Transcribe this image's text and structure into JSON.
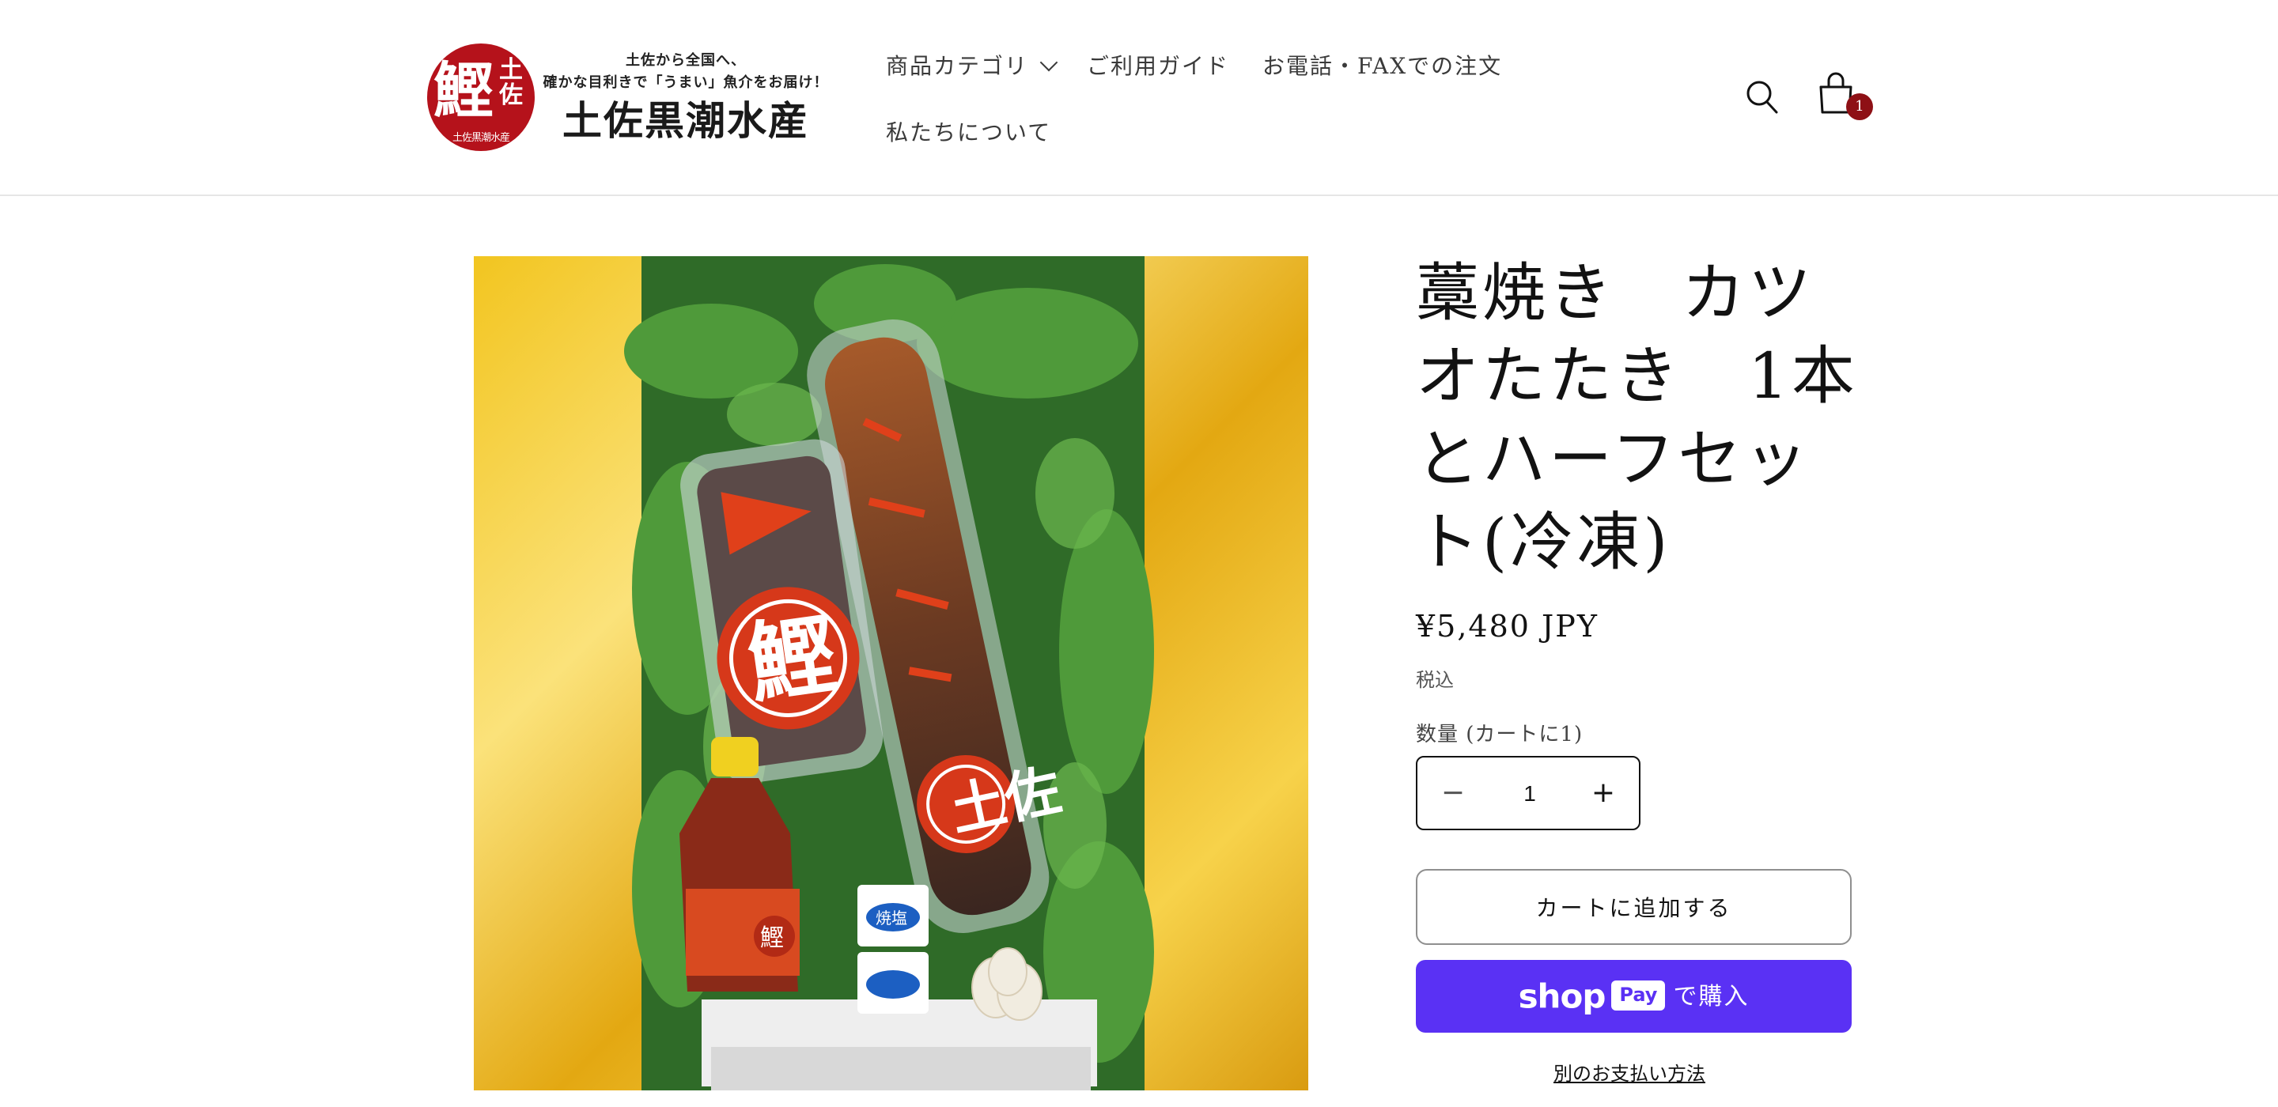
{
  "header": {
    "logo": {
      "seal_main": "鰹",
      "seal_side": "土佐",
      "seal_ring": "土佐黒潮水産",
      "tagline_1": "土佐から全国へ、",
      "tagline_2": "確かな目利きで「うまい」魚介をお届け！",
      "brand_name": "土佐黒潮水産"
    },
    "nav": {
      "categories": "商品カテゴリ",
      "guide": "ご利用ガイド",
      "phone_order": "お電話・FAXでの注文",
      "about": "私たちについて"
    },
    "cart_count": "1"
  },
  "product": {
    "title": "藁焼き　カツオたたき　1本とハーフセット(冷凍)",
    "price": "¥5,480 JPY",
    "tax_note": "税込",
    "quantity_label": "数量 (カートに1)",
    "quantity_value": "1",
    "add_to_cart": "カートに追加する",
    "shop_pay": {
      "brand": "shop",
      "chip": "Pay",
      "suffix": "で購入"
    },
    "more_payment": "別のお支払い方法"
  },
  "image": {
    "package_big_label": "鰹",
    "package_side_label": "土佐",
    "bottle_label": "鰹",
    "salt_label": "焼塩"
  },
  "colors": {
    "brand_red": "#b5121b",
    "badge": "#8e1015",
    "shop_pay": "#5a31f4",
    "gold": "#e8b520"
  }
}
